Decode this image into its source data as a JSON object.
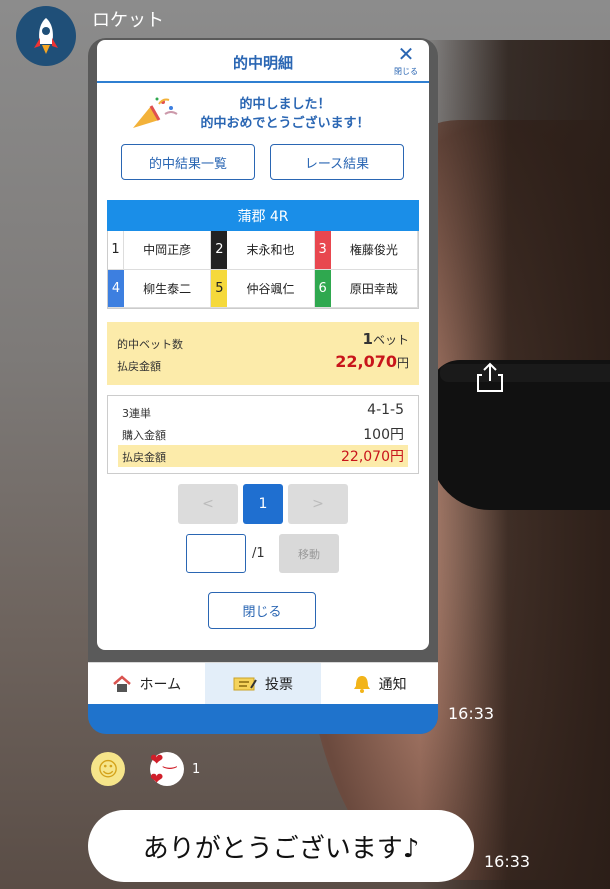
{
  "sender": {
    "name": "ロケット"
  },
  "modal": {
    "title": "的中明細",
    "close_label": "閉じる",
    "congrats_line1": "的中しました！",
    "congrats_line2": "的中おめでとうございます！",
    "btn_hit_list": "的中結果一覧",
    "btn_race_result": "レース結果",
    "race_title": "蒲郡 4R",
    "racers": [
      {
        "num": "1",
        "name": "中岡正彦",
        "color": "#ffffff",
        "text": "#222222"
      },
      {
        "num": "2",
        "name": "末永和也",
        "color": "#222222",
        "text": "#ffffff"
      },
      {
        "num": "3",
        "name": "権藤俊光",
        "color": "#e8474f",
        "text": "#ffffff"
      },
      {
        "num": "4",
        "name": "柳生泰二",
        "color": "#3d7fe0",
        "text": "#ffffff"
      },
      {
        "num": "5",
        "name": "仲谷颯仁",
        "color": "#f5d93b",
        "text": "#222222"
      },
      {
        "num": "6",
        "name": "原田幸哉",
        "color": "#2fa84f",
        "text": "#ffffff"
      }
    ],
    "summary": {
      "hit_bets_label": "的中ベット数",
      "hit_bets_value": "1",
      "hit_bets_unit": "ベット",
      "payout_label": "払戻金額",
      "payout_value": "22,070",
      "payout_unit": "円"
    },
    "bet": {
      "type_label": "3連単",
      "type_value": "4-1-5",
      "purchase_label": "購入金額",
      "purchase_value": "100円",
      "payout_label": "払戻金額",
      "payout_value": "22,070円"
    },
    "pager": {
      "prev": "<",
      "current": "1",
      "next": ">",
      "total": "/1",
      "move": "移動"
    },
    "close_button": "閉じる"
  },
  "nav": {
    "home": "ホーム",
    "vote": "投票",
    "notice": "通知"
  },
  "messages": {
    "time1": "16:33",
    "reaction_count": "1",
    "text": "ありがとうございます♪",
    "time2": "16:33"
  },
  "colors": {
    "accent": "#2a66b3",
    "race_head": "#1a8ee8",
    "highlight": "#fcebaa",
    "payout_red": "#c8151b"
  }
}
